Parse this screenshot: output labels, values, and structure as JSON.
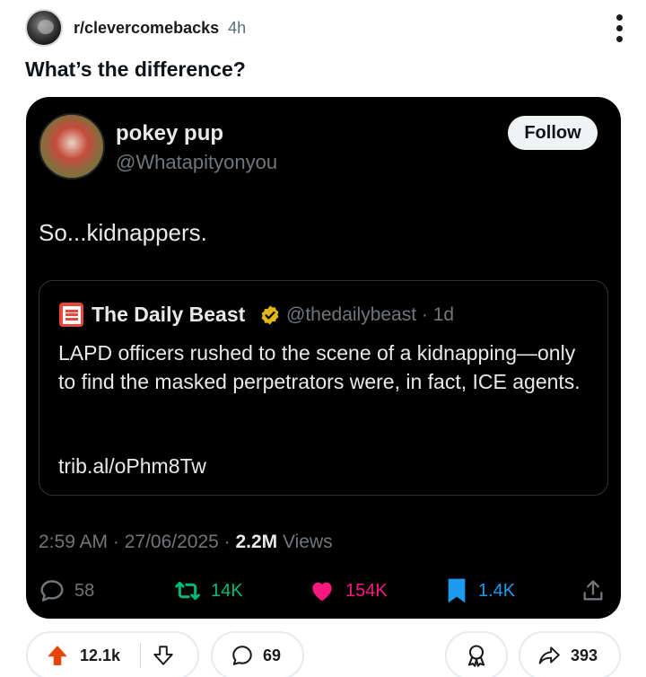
{
  "header": {
    "subreddit": "r/clevercomebacks",
    "time": "4h",
    "overflow_icon": "more-vertical-icon"
  },
  "post": {
    "title": "What’s the difference?"
  },
  "tweet": {
    "author_name": "pokey pup",
    "author_handle": "@Whatapityonyou",
    "follow_label": "Follow",
    "text": "So...kidnappers.",
    "quote": {
      "source_name": "The Daily Beast",
      "handle_and_time": "@thedailybeast · 1d",
      "body": "LAPD officers rushed to the scene of a kidnapping—only to find the masked perpetrators were, in fact, ICE agents.",
      "link": "trib.al/oPhm8Tw",
      "logo_text": "DAILY BEAST",
      "badge_color": "#e2b719"
    },
    "meta": {
      "timestamp": "2:59 AM · 27/06/2025 · ",
      "views_count": "2.2M",
      "views_label": " Views"
    },
    "actions": {
      "replies": "58",
      "retweets": "14K",
      "likes": "154K",
      "bookmarks": "1.4K"
    },
    "colors": {
      "retweet": "#00ba7c",
      "like": "#f91880",
      "bookmark": "#1d9bf0",
      "muted": "#71767b"
    }
  },
  "post_actions": {
    "upvotes": "12.1k",
    "comments": "69",
    "shares": "393",
    "upvote_color": "#e8440a"
  }
}
